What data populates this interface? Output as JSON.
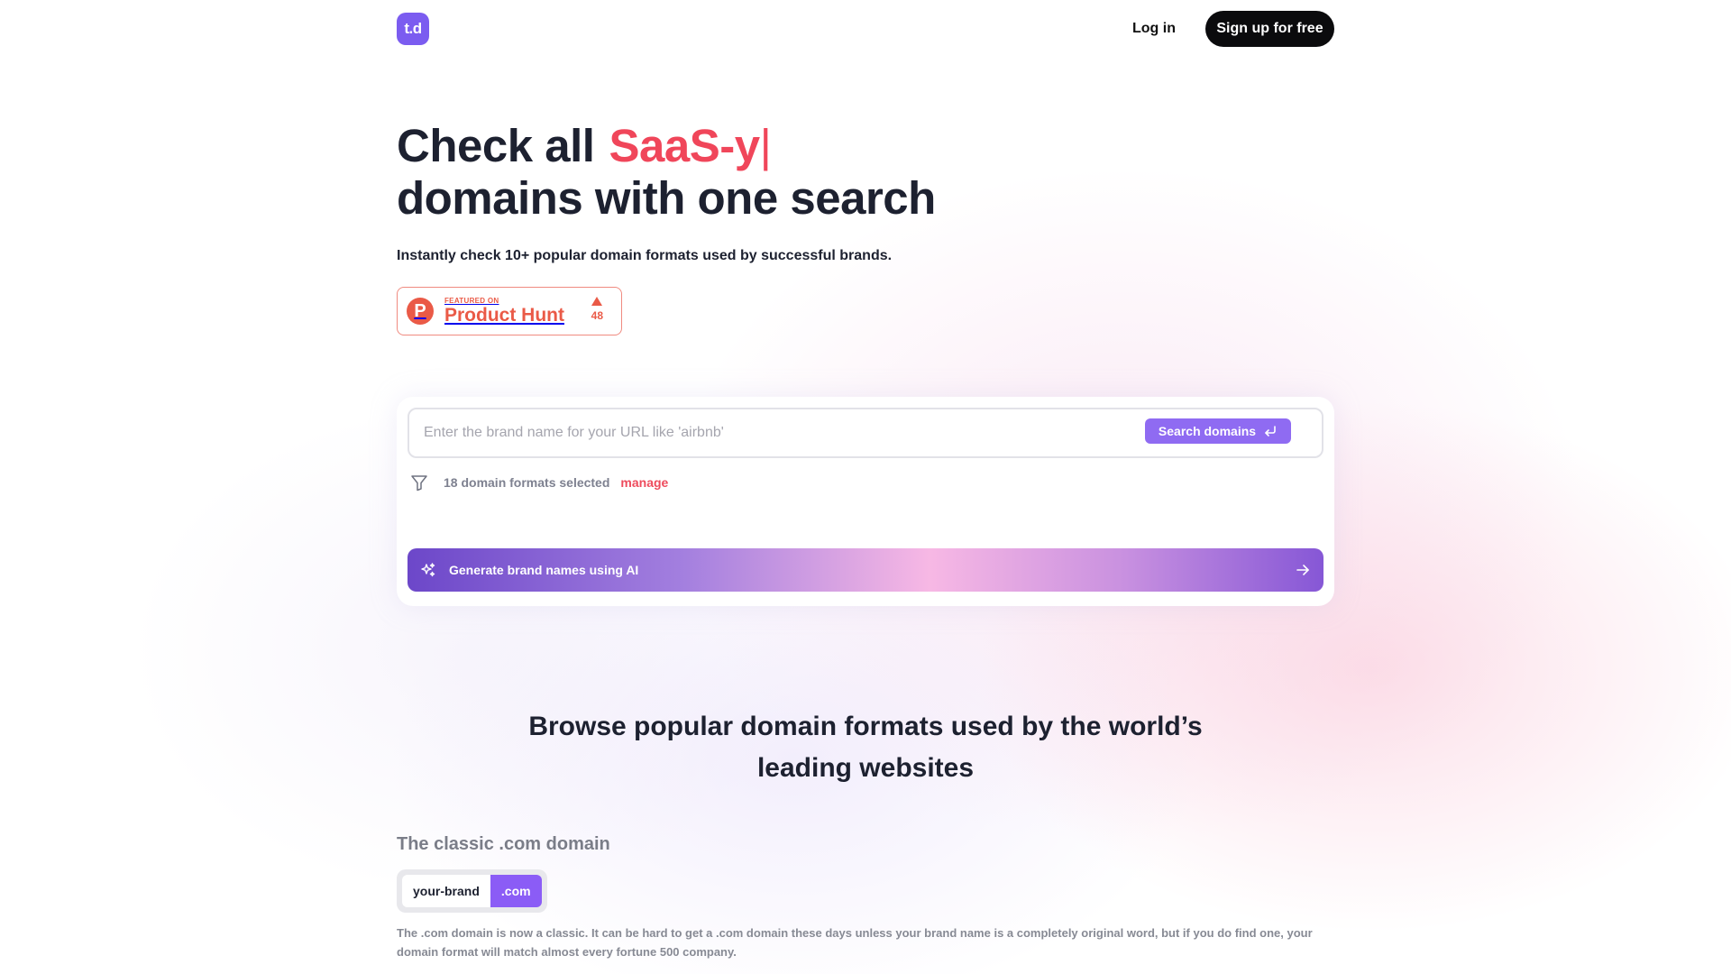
{
  "header": {
    "logo_text": "t.d",
    "login_label": "Log in",
    "signup_label": "Sign up for free"
  },
  "hero": {
    "title_prefix": "Check all",
    "title_accent": "SaaS-y",
    "title_cursor": "|",
    "title_line2": "domains with one search",
    "subtitle": "Instantly check 10+ popular domain formats used by successful brands."
  },
  "product_hunt": {
    "logo_letter": "P",
    "featured_label": "FEATURED ON",
    "name": "Product Hunt",
    "votes": "48"
  },
  "search": {
    "placeholder": "Enter the brand name for your URL like 'airbnb'",
    "value": "",
    "button_label": "Search domains",
    "formats_selected": "18 domain formats selected",
    "manage_label": "manage",
    "ai_label": "Generate brand names using AI"
  },
  "browse": {
    "title_line1": "Browse popular domain formats used by the world’s",
    "title_line2": "leading websites",
    "section_title": "The classic .com domain",
    "example_name": "your-brand",
    "example_tld": ".com",
    "description": "The .com domain is now a classic. It can be hard to get a .com domain these days unless your brand name is a completely original word, but if you do find one, your domain format will match almost every fortune 500 company."
  },
  "colors": {
    "accent": "#f0465a",
    "brand_purple": "#8f6bf2",
    "product_hunt": "#ea5a47"
  },
  "icons": {
    "search_button": "return-arrow-icon",
    "formats": "filter-icon",
    "ai": "sparkles-icon",
    "ai_arrow": "arrow-right-icon"
  }
}
